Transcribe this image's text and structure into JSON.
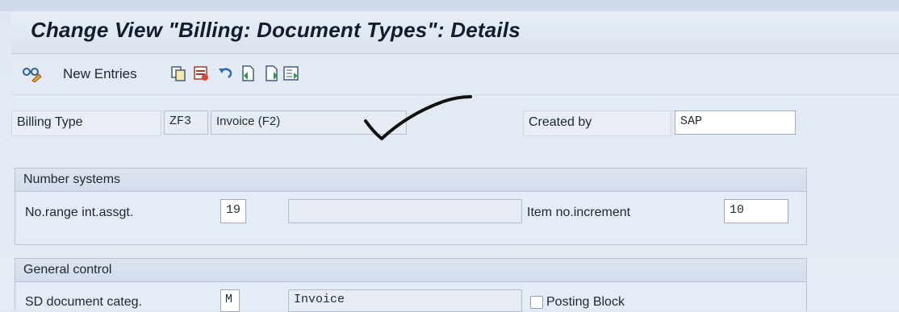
{
  "window": {
    "title": "Change View \"Billing: Document Types\": Details"
  },
  "toolbar": {
    "new_entries_label": "New Entries",
    "icons": [
      "display-change-icon",
      "copy-icon",
      "delete-icon",
      "undo-icon",
      "previous-entry-icon",
      "next-entry-icon",
      "transport-icon"
    ]
  },
  "header_fields": {
    "billing_type_label": "Billing Type",
    "billing_type_code": "ZF3",
    "billing_type_desc": "Invoice (F2)",
    "created_by_label": "Created by",
    "created_by_value": "SAP"
  },
  "number_systems": {
    "title": "Number systems",
    "range_label": "No.range int.assgt.",
    "range_value": "19",
    "range_desc": "",
    "increment_label": "Item no.increment",
    "increment_value": "10"
  },
  "general_control": {
    "title": "General control",
    "categ_label": "SD document categ.",
    "categ_value": "M",
    "categ_desc": "Invoice",
    "posting_block_label": "Posting Block",
    "posting_block_checked": false
  },
  "annotation": {
    "mark": "handwritten-checkmark",
    "color": "#111111"
  },
  "colors": {
    "background": "#dfe6f2",
    "group_header": "#d2dcea",
    "input_bg": "#ffffff"
  }
}
